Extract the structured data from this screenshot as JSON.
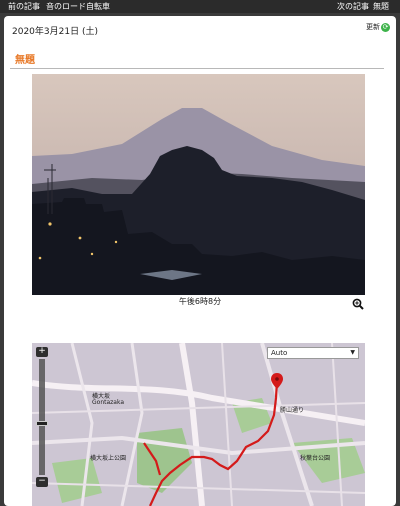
{
  "nav": {
    "prev": "前の記事",
    "blog_name": "音のロード自転車",
    "next": "次の記事",
    "untitled": "無題"
  },
  "post": {
    "date": "2020年3月21日 (土)",
    "update_label": "更新",
    "title": "無題",
    "photo_caption": "午後6時8分"
  },
  "map": {
    "type_select": "Auto",
    "labels": {
      "place1": "横大坂",
      "place1_romaji": "Gontazaka",
      "place2": "横大坂上公園",
      "place3": "勝山通り",
      "place4": "秋葉台公園"
    }
  },
  "colors": {
    "orange_title": "#e87a2a",
    "route_red": "#d41a1a",
    "update_green": "#3db34a"
  }
}
